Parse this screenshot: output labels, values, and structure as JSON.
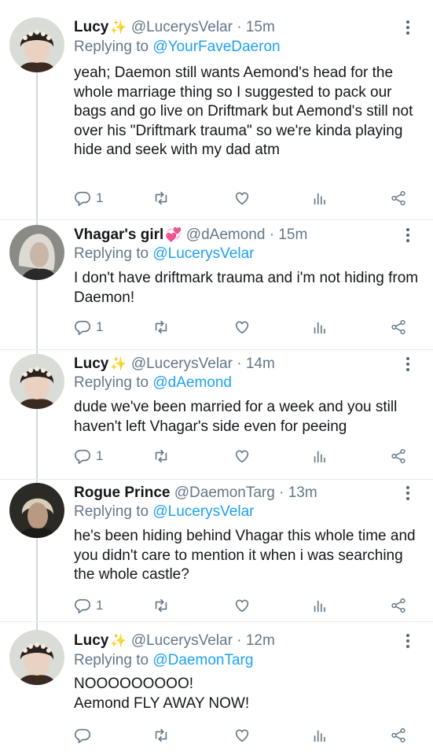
{
  "tweets": [
    {
      "name": "Lucy",
      "name_emoji": "✨",
      "handle": "@LucerysVelar",
      "time": "· 15m",
      "replying_prefix": "Replying to",
      "replying_to": "@YourFaveDaeron",
      "text": "yeah; Daemon still wants Aemond's head for the whole marriage thing so I suggested to pack our bags and go live on Driftmark but Aemond's still not over his \"Driftmark trauma\" so we're kinda playing hide and seek with my dad atm",
      "reply_count": "1",
      "avatar": "lucy-avatar"
    },
    {
      "name": "Vhagar's girl",
      "name_emoji": "💞",
      "handle": "@dAemond",
      "time": "· 15m",
      "replying_prefix": "Replying to",
      "replying_to": "@LucerysVelar",
      "text": "I don't have driftmark trauma and i'm not hiding from Daemon!",
      "reply_count": "1",
      "avatar": "aemond-avatar"
    },
    {
      "name": "Lucy",
      "name_emoji": "✨",
      "handle": "@LucerysVelar",
      "time": "· 14m",
      "replying_prefix": "Replying to",
      "replying_to": "@dAemond",
      "text": "dude we've been married for a week and you still haven't left Vhagar's side even for peeing",
      "reply_count": "1",
      "avatar": "lucy-avatar"
    },
    {
      "name": "Rogue Prince",
      "name_emoji": "",
      "handle": "@DaemonTarg",
      "time": "· 13m",
      "replying_prefix": "Replying to",
      "replying_to": "@LucerysVelar",
      "text": "he's been hiding behind Vhagar this whole time and you didn't care to mention it when i was searching the whole castle?",
      "reply_count": "1",
      "avatar": "daemon-avatar"
    },
    {
      "name": "Lucy",
      "name_emoji": "✨",
      "handle": "@LucerysVelar",
      "time": "· 12m",
      "replying_prefix": "Replying to",
      "replying_to": "@DaemonTarg",
      "text": "NOOOOOOOOO!\nAemond FLY AWAY NOW!",
      "reply_count": "",
      "avatar": "lucy-avatar"
    }
  ],
  "colors": {
    "link": "#1da1f2",
    "muted": "#657786",
    "text": "#14171a",
    "thread_line": "#cfd9de"
  }
}
